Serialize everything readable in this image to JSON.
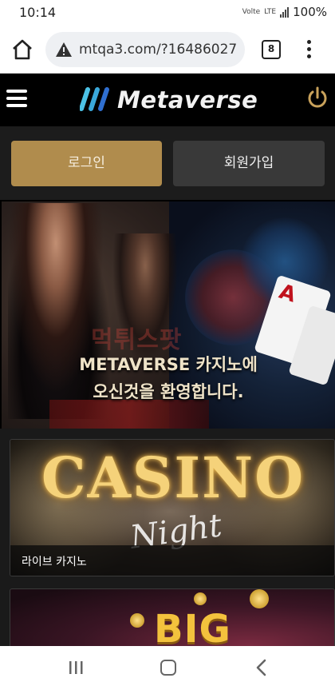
{
  "status_bar": {
    "time": "10:14",
    "network_small": "Volte",
    "network_type": "LTE",
    "battery": "100%"
  },
  "browser": {
    "url": "mtqa3.com/?16486027",
    "tab_count": "8"
  },
  "header": {
    "brand": "Metaverse"
  },
  "auth": {
    "login_label": "로그인",
    "signup_label": "회원가입"
  },
  "banner": {
    "watermark": "먹튀스팟",
    "line1": "METAVERSE 카지노에",
    "line2": "오신것을 환영합니다."
  },
  "games": [
    {
      "title": "CASINO",
      "subtitle": "Night",
      "caption": "라이브 카지노"
    },
    {
      "title": "BIG WIN"
    }
  ],
  "colors": {
    "gold": "#b08c4d",
    "dark_button": "#393939",
    "header_bg": "#000000",
    "logo_blue": "#3fb3e0"
  }
}
